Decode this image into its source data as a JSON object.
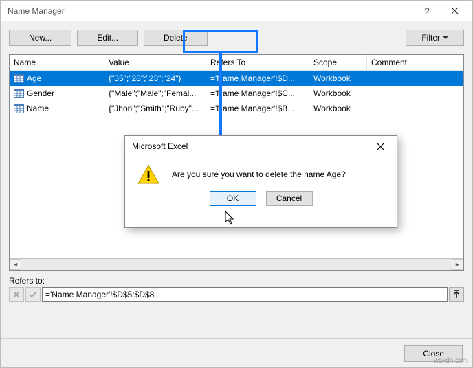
{
  "title": "Name Manager",
  "toolbar": {
    "new_label": "New...",
    "edit_label": "Edit...",
    "delete_label": "Delete",
    "filter_label": "Filter"
  },
  "columns": {
    "name": "Name",
    "value": "Value",
    "refers": "Refers To",
    "scope": "Scope",
    "comment": "Comment"
  },
  "rows": [
    {
      "name": "Age",
      "value": "{\"35\";\"28\";\"23\";\"24\"}",
      "refers": "='Name Manager'!$D...",
      "scope": "Workbook",
      "comment": "",
      "selected": true
    },
    {
      "name": "Gender",
      "value": "{\"Male\";\"Male\";\"Femal...",
      "refers": "='Name Manager'!$C...",
      "scope": "Workbook",
      "comment": "",
      "selected": false
    },
    {
      "name": "Name",
      "value": "{\"Jhon\";\"Smith\";\"Ruby\"...",
      "refers": "='Name Manager'!$B...",
      "scope": "Workbook",
      "comment": "",
      "selected": false
    }
  ],
  "refers_label": "Refers to:",
  "refers_value": "='Name Manager'!$D$5:$D$8",
  "close_label": "Close",
  "dialog": {
    "title": "Microsoft Excel",
    "message": "Are you sure you want to delete the name Age?",
    "ok": "OK",
    "cancel": "Cancel"
  },
  "watermark": "wsxdn.com"
}
